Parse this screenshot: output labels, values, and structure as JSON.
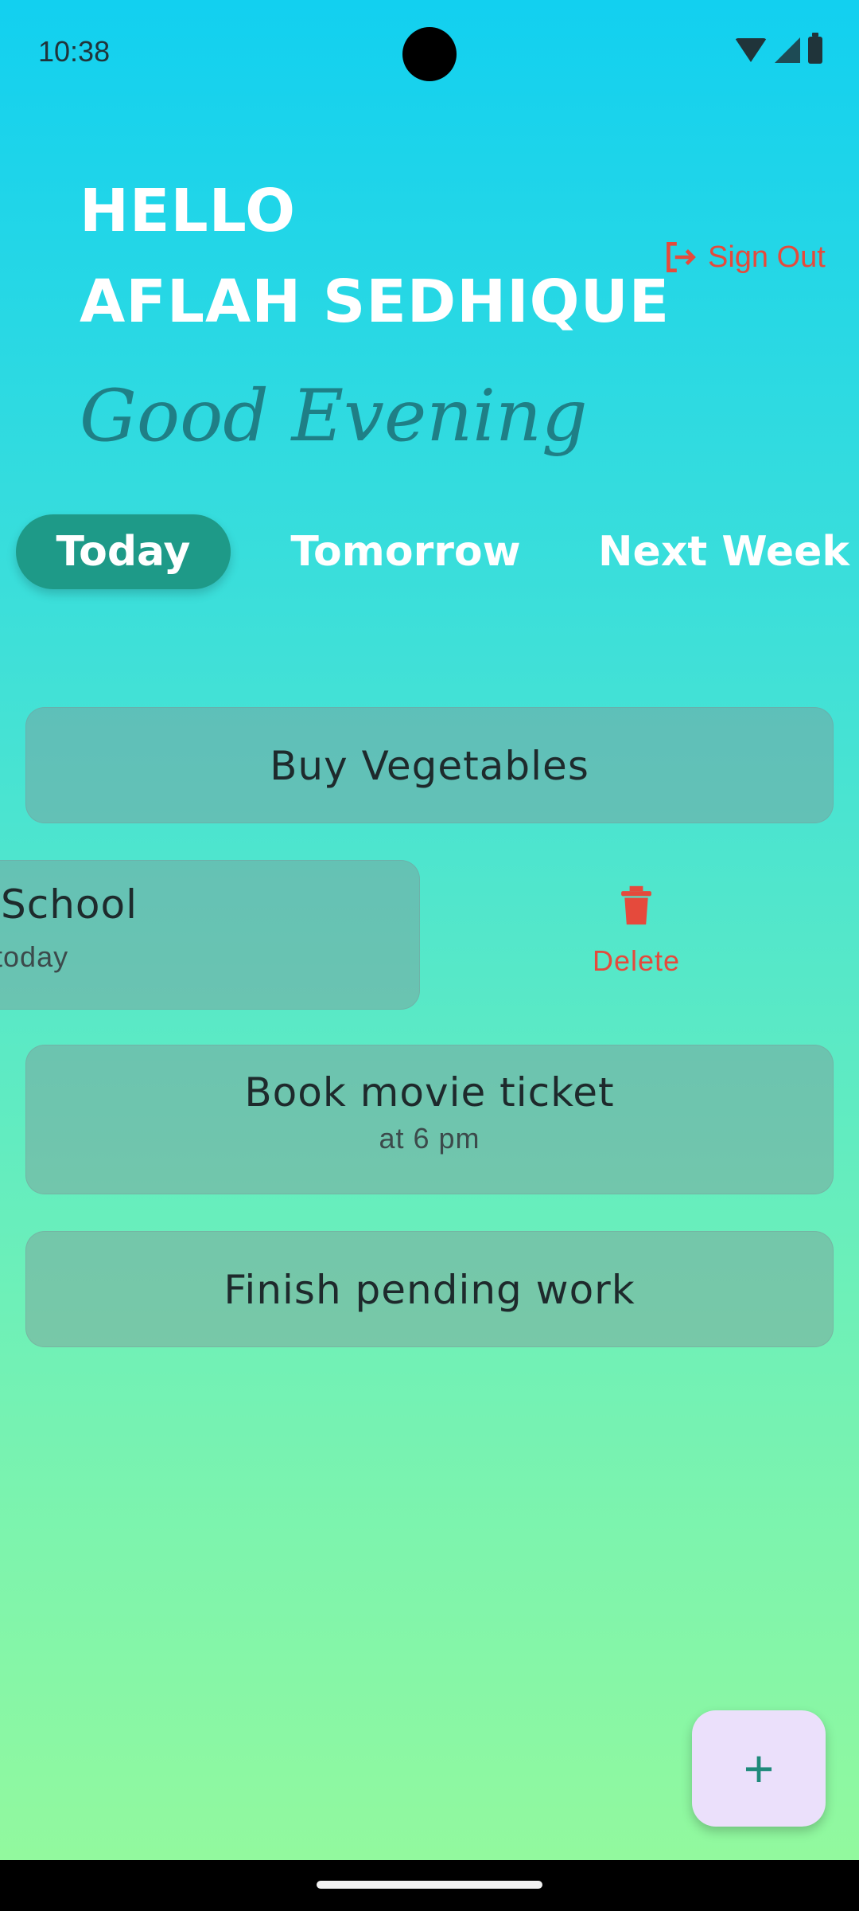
{
  "status_bar": {
    "time": "10:38"
  },
  "header": {
    "greeting_line1": "HELLO",
    "greeting_line2": "AFLAH SEDHIQUE",
    "subtitle": "Good Evening",
    "sign_out_label": "Sign Out"
  },
  "tabs": [
    {
      "label": "Today",
      "selected": true
    },
    {
      "label": "Tomorrow",
      "selected": false
    },
    {
      "label": "Next Week",
      "selected": false
    }
  ],
  "tasks": [
    {
      "title": "Buy Vegetables",
      "subtitle": ""
    },
    {
      "title": "School",
      "subtitle": "n today",
      "swiped": true
    },
    {
      "title": "Book movie ticket",
      "subtitle": "at 6 pm"
    },
    {
      "title": "Finish pending work",
      "subtitle": ""
    }
  ],
  "swipe_action": {
    "label": "Delete",
    "icon": "trash-icon"
  },
  "fab": {
    "icon": "plus-icon",
    "glyph": "+"
  },
  "colors": {
    "accent": "#1e9a88",
    "danger": "#e54a3c",
    "fab_bg": "#ebe0fb"
  }
}
